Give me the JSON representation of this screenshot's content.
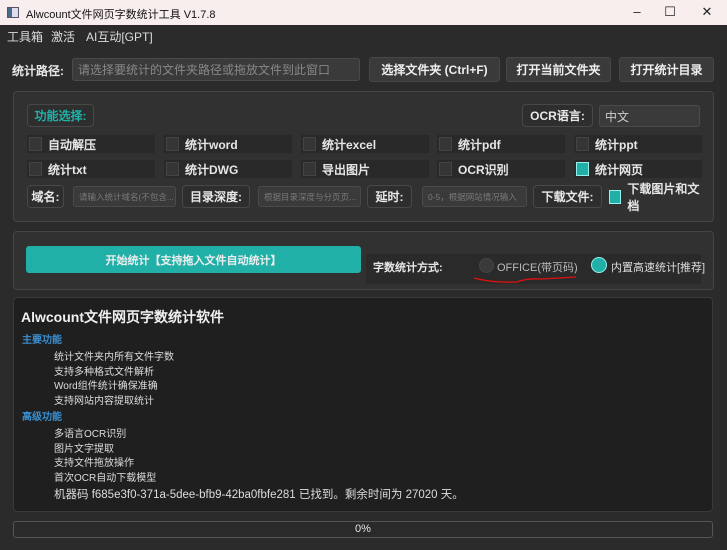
{
  "window": {
    "title": "Alwcount文件网页字数统计工具 V1.7.8",
    "minimize": "–",
    "maximize": "☐",
    "close": "✕"
  },
  "menu": [
    "工具箱",
    "激活",
    "AI互动[GPT]"
  ],
  "path": {
    "label": "统计路径:",
    "placeholder": "请选择要统计的文件夹路径或拖放文件到此窗口",
    "select_button": "选择文件夹 (Ctrl+F)",
    "open_current": "打开当前文件夹",
    "open_stats": "打开统计目录"
  },
  "options": {
    "func_label": "功能选择:",
    "ocr_lang_label": "OCR语言:",
    "ocr_lang_value": "中文",
    "checkboxes": [
      {
        "label": "自动解压",
        "checked": false
      },
      {
        "label": "统计word",
        "checked": false
      },
      {
        "label": "统计excel",
        "checked": false
      },
      {
        "label": "统计pdf",
        "checked": false
      },
      {
        "label": "统计ppt",
        "checked": false
      },
      {
        "label": "统计txt",
        "checked": false
      },
      {
        "label": "统计DWG",
        "checked": false
      },
      {
        "label": "导出图片",
        "checked": false
      },
      {
        "label": "OCR识别",
        "checked": false
      },
      {
        "label": "统计网页",
        "checked": true
      }
    ],
    "domain_label": "域名:",
    "domain_placeholder": "请输入统计域名(不包含...",
    "depth_label": "目录深度:",
    "depth_placeholder": "根据目录深度与分页页...",
    "delay_label": "延时:",
    "delay_placeholder": "0-5，根据网站情况输入",
    "download_label": "下载文件:",
    "download_checkbox": "下载图片和文档",
    "download_checked": true
  },
  "run": {
    "start_button": "开始统计【支持拖入文件自动统计】",
    "method_label": "字数统计方式:",
    "radio_office": "OFFICE(带页码)",
    "radio_builtin": "内置高速统计[推荐]",
    "selected": "builtin"
  },
  "info": {
    "title": "Alwcount文件网页字数统计软件",
    "sections": [
      {
        "heading": "主要功能",
        "items": [
          "统计文件夹内所有文件字数",
          "支持多种格式文件解析",
          "Word组件统计确保准确",
          "支持网站内容提取统计"
        ]
      },
      {
        "heading": "高级功能",
        "items": [
          "多语言OCR识别",
          "图片文字提取",
          "支持文件拖放操作",
          "首次OCR自动下载模型"
        ]
      }
    ],
    "machine": "机器码 f685e3f0-371a-5dee-bfb9-42ba0fbfe281 已找到。剩余时间为 27020 天。"
  },
  "progress": {
    "text": "0%",
    "value": 0
  },
  "colors": {
    "accent": "#21b0a8",
    "heading": "#3a8fd0"
  }
}
